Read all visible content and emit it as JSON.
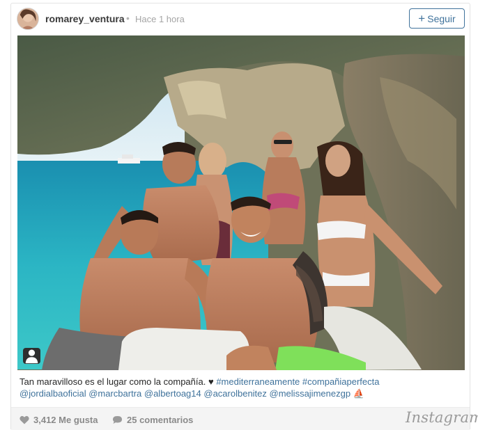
{
  "post": {
    "username": "romarey_ventura",
    "separator": "•",
    "time_ago": "Hace 1 hora",
    "follow_label": "Seguir",
    "follow_plus": "+"
  },
  "caption": {
    "text": "Tan maravilloso es el lugar como la compañía.",
    "heart": "♥",
    "hashtags": [
      "#mediterraneamente",
      "#compañiaperfecta"
    ],
    "mentions": [
      "@jordialbaoficial",
      "@marcbartra",
      "@albertoag14",
      "@acarolbenitez",
      "@melissajimenezgp"
    ],
    "trailing_emoji": "⛵"
  },
  "footer": {
    "likes": "3,412 Me gusta",
    "comments": "25 comentarios",
    "brand": "Instagram"
  },
  "icons": {
    "heart": "heart-icon",
    "comment": "comment-icon",
    "tag": "user-tag-icon",
    "plus": "plus-icon"
  },
  "colors": {
    "link": "#3f729b",
    "muted": "#8a8a8a"
  }
}
